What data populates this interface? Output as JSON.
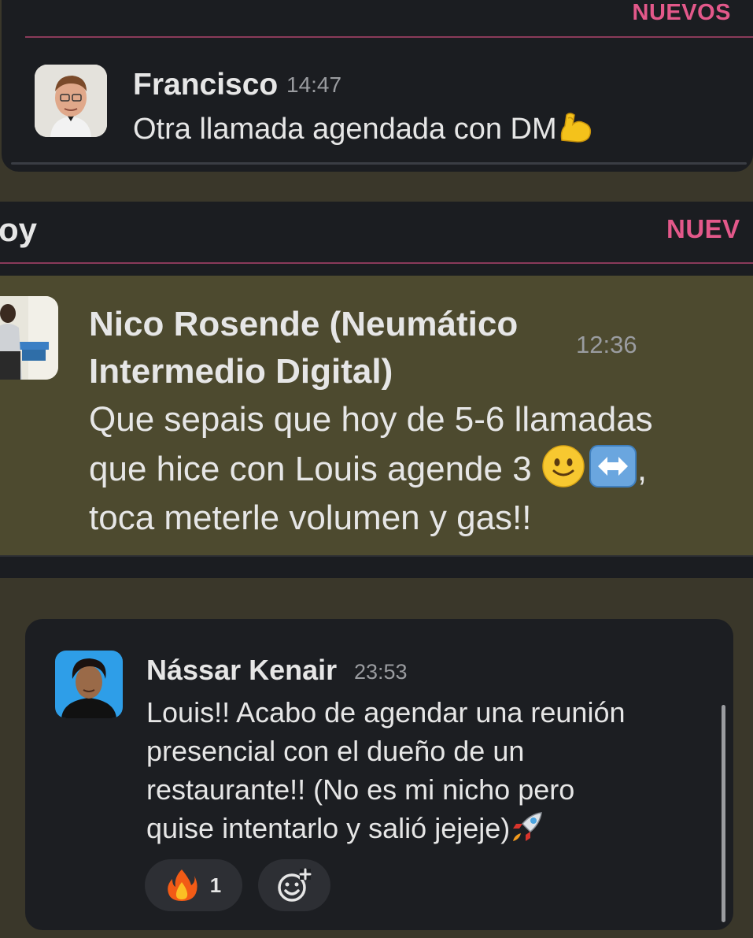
{
  "panel1": {
    "new_label": "NUEVOS",
    "message": {
      "author": "Francisco",
      "time": "14:47",
      "text": "Otra llamada agendada con DM"
    }
  },
  "panel2": {
    "day_label": "oy",
    "new_label": "NUEV",
    "message": {
      "author_line1": "Nico Rosende (Neumático",
      "author_line2": "Intermedio Digital)",
      "time": "12:36",
      "text_line1": "Que sepais que hoy de 5-6 llamadas",
      "text_line2": "que hice con Louis agende 3",
      "text_line2_suffix": ",",
      "text_line3": "toca meterle volumen y gas!!"
    }
  },
  "panel3": {
    "message": {
      "author": "Nássar Kenair",
      "time": "23:53",
      "text_line1": "Louis!! Acabo de agendar una reunión",
      "text_line2": "presencial con el dueño de un",
      "text_line3": "restaurante!! (No es mi nicho pero",
      "text_line4": "quise intentarlo y salió jejeje)"
    },
    "reactions": [
      {
        "icon": "fire-emoji",
        "count": "1"
      },
      {
        "icon": "add-reaction-icon"
      }
    ]
  },
  "colors": {
    "panel_bg": "#1b1d21",
    "highlight_bg": "#4d4a2f",
    "accent_pink": "#e3588a",
    "text": "#e6e6e6",
    "muted": "#9a9ca0"
  }
}
